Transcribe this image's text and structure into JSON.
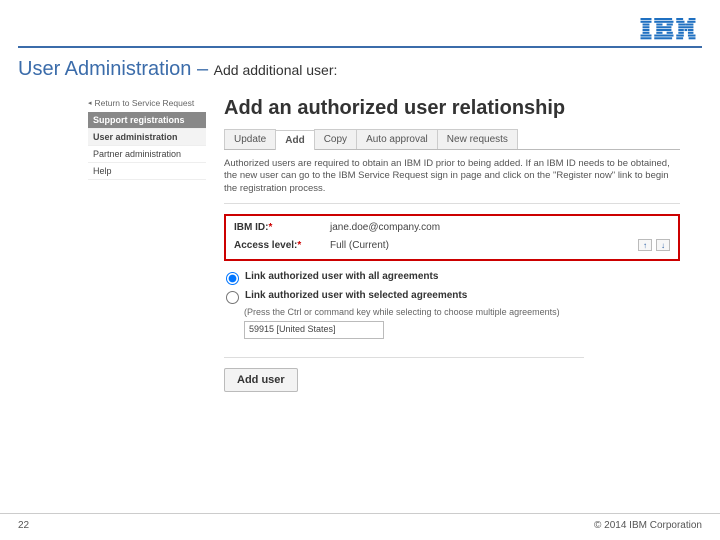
{
  "logo_alt": "IBM",
  "title_main": "User Administration – ",
  "title_sub": "Add additional user:",
  "back_link": "Return to Service Request",
  "sidebar": {
    "header": "Support registrations",
    "items": [
      "User administration",
      "Partner administration",
      "Help"
    ]
  },
  "page_heading": "Add an authorized user relationship",
  "tabs": [
    "Update",
    "Add",
    "Copy",
    "Auto approval",
    "New requests"
  ],
  "instruction": "Authorized users are required to obtain an IBM ID prior to being added. If an IBM ID needs to be obtained, the new user can go to the IBM Service Request sign in page and click on the \"Register now\" link to begin the registration process.",
  "form": {
    "ibm_id_label": "IBM ID:",
    "ibm_id_value": "jane.doe@company.com",
    "access_label": "Access level:",
    "access_value": "Full (Current)"
  },
  "radios": {
    "all_label": "Link authorized user with all agreements",
    "sel_label": "Link authorized user with selected agreements",
    "sel_note": "(Press the Ctrl or command key while selecting to choose multiple agreements)",
    "list_item": "59915   [United States]"
  },
  "add_button": "Add user",
  "page_number": "22",
  "copyright": "© 2014 IBM Corporation"
}
